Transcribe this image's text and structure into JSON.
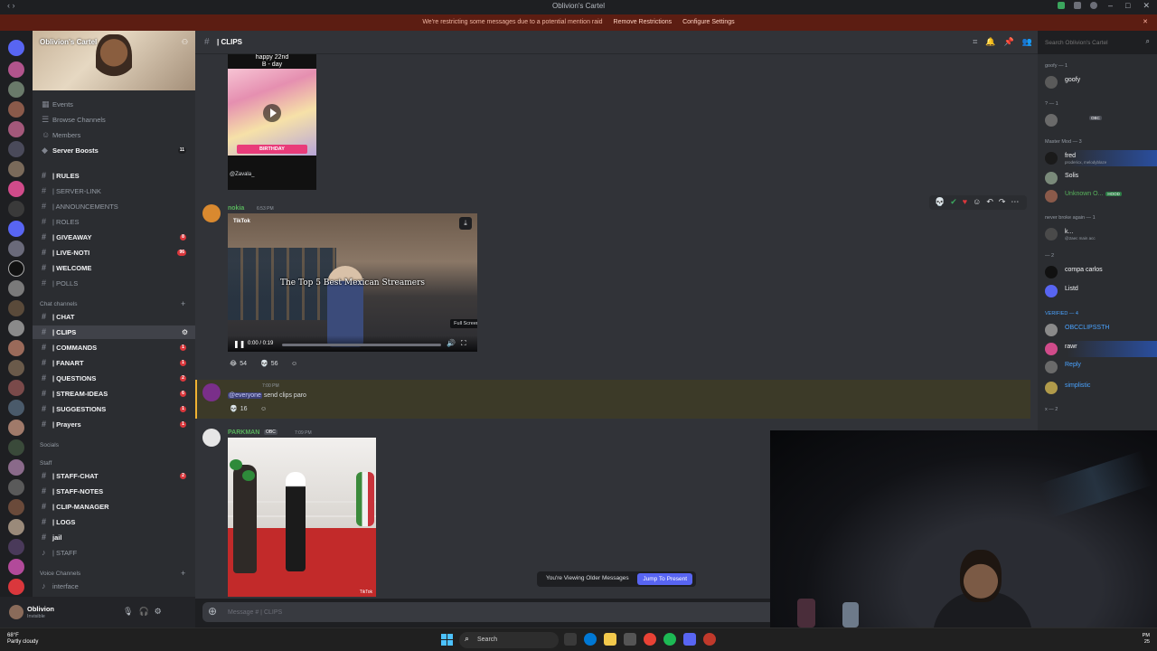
{
  "window": {
    "title": "Oblivion's Cartel"
  },
  "notice": {
    "text": "We're restricting some messages due to a potential mention raid",
    "remove": "Remove Restrictions",
    "configure": "Configure Settings"
  },
  "server": {
    "name": "Oblivion's Cartel"
  },
  "sidebar": {
    "top_items": [
      {
        "label": "Events"
      },
      {
        "label": "Browse Channels"
      },
      {
        "label": "Members"
      },
      {
        "label": "Server Boosts",
        "badge": "11"
      }
    ],
    "channels_a": [
      {
        "label": "| RULES"
      },
      {
        "label": "| SERVER-LINK"
      },
      {
        "label": "| ANNOUNCEMENTS"
      },
      {
        "label": "| ROLES"
      },
      {
        "label": "| GIVEAWAY",
        "badge": "8"
      },
      {
        "label": "| LIVE-NOTI",
        "badge": "96"
      },
      {
        "label": "| WELCOME"
      },
      {
        "label": "| POLLS"
      }
    ],
    "cat_chat": "Chat channels",
    "channels_b": [
      {
        "label": "| CHAT"
      },
      {
        "label": "| CLIPS"
      },
      {
        "label": "| COMMANDS",
        "badge": "1"
      },
      {
        "label": "| FANART",
        "badge": "1"
      },
      {
        "label": "| QUESTIONS",
        "badge": "2"
      },
      {
        "label": "| STREAM-IDEAS",
        "badge": "6"
      },
      {
        "label": "| SUGGESTIONS",
        "badge": "1"
      },
      {
        "label": "| Prayers",
        "badge": "1"
      }
    ],
    "cat_socials": "Socials",
    "cat_staff": "Staff",
    "channels_c": [
      {
        "label": "| STAFF-CHAT",
        "badge": "2"
      },
      {
        "label": "| STAFF-NOTES"
      },
      {
        "label": "| CLIP-MANAGER"
      },
      {
        "label": "| LOGS"
      },
      {
        "label": "jail"
      },
      {
        "label": "| STAFF"
      }
    ],
    "cat_voice": "Voice Channels",
    "voice": [
      {
        "label": "interface"
      }
    ]
  },
  "user": {
    "name": "Oblivion",
    "status": "Invisible"
  },
  "header": {
    "channel": "| CLIPS",
    "search_placeholder": "Search Oblivion's Cartel"
  },
  "messages": {
    "card1_line1": "happy 22nd",
    "card1_line2": "B - day",
    "card1_banner": "BIRTHDAY",
    "card1_credit": "@Zavala_",
    "m1_author": "nokia",
    "m1_time": "6:53 PM",
    "video1_caption": "The Top 5 Best Mexican Streamers",
    "video1_time": "0:00 / 0:19",
    "video1_tooltip": "Full Screen",
    "video1_brand": "TikTok",
    "r1_a": "54",
    "r1_b": "56",
    "m2_time": "7:00 PM",
    "m2_mention": "@everyone",
    "m2_text": " send clips paro",
    "r2_a": "16",
    "m3_author": "PARKMAN",
    "m3_tag": "OBC",
    "m3_time": "7:09 PM",
    "video2_wm": "TikTok"
  },
  "older": {
    "text": "You're Viewing Older Messages",
    "button": "Jump To Present"
  },
  "composer": {
    "placeholder": "Message # | CLIPS"
  },
  "members": {
    "g1": "goofy — 1",
    "g2": "? — 1",
    "g3": "Master Mod — 3",
    "g4": "never broke again — 1",
    "g5": "— 2",
    "g6": "VERIFIED — 4",
    "g7": "x — 2",
    "list": {
      "goofy": "goofy",
      "obc": "OBC",
      "fred": "fred",
      "fred_sub": "prodericx, melodyblaze",
      "solis": "Solis",
      "unknown": "Unknown O...",
      "hood": "HOOD",
      "k": "k...",
      "k_sub": "@2aec main acc",
      "compa": "compa carlos",
      "listd": "Listd",
      "obcclips": "OBCCLIPSSTH",
      "rawr": "rawr",
      "reply": "Reply",
      "simplistic": "simplistic"
    }
  },
  "taskbar": {
    "temp": "68°F",
    "weather": "Partly cloudy",
    "search": "Search",
    "time": "PM",
    "date": "25"
  }
}
